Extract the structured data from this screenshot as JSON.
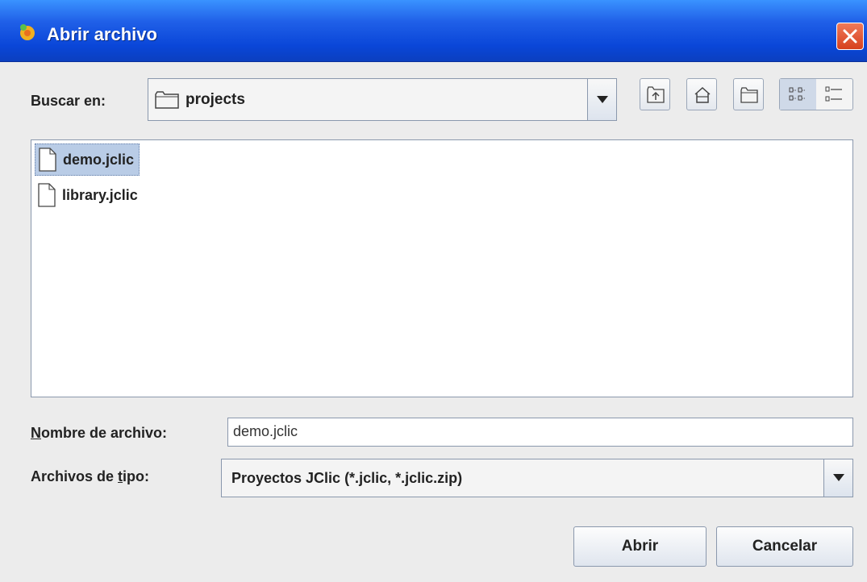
{
  "window": {
    "title": "Abrir archivo"
  },
  "lookin": {
    "label": "Buscar en:",
    "value": "projects"
  },
  "toolbar": {
    "up_icon": "folder-up-icon",
    "home_icon": "home-icon",
    "newfolder_icon": "new-folder-icon",
    "list_icon": "list-view-icon",
    "details_icon": "details-view-icon"
  },
  "files": [
    {
      "name": "demo.jclic",
      "selected": true
    },
    {
      "name": "library.jclic",
      "selected": false
    }
  ],
  "filename": {
    "label_first": "N",
    "label_rest": "ombre de archivo:",
    "value": "demo.jclic"
  },
  "filetype": {
    "label_pre": "Archivos de ",
    "label_u": "t",
    "label_post": "ipo:",
    "value": "Proyectos JClic (*.jclic, *.jclic.zip)"
  },
  "buttons": {
    "open": "Abrir",
    "cancel": "Cancelar"
  },
  "colors": {
    "titlebar": "#0a46d8",
    "selection": "#b9cce6",
    "close": "#d6401e"
  }
}
